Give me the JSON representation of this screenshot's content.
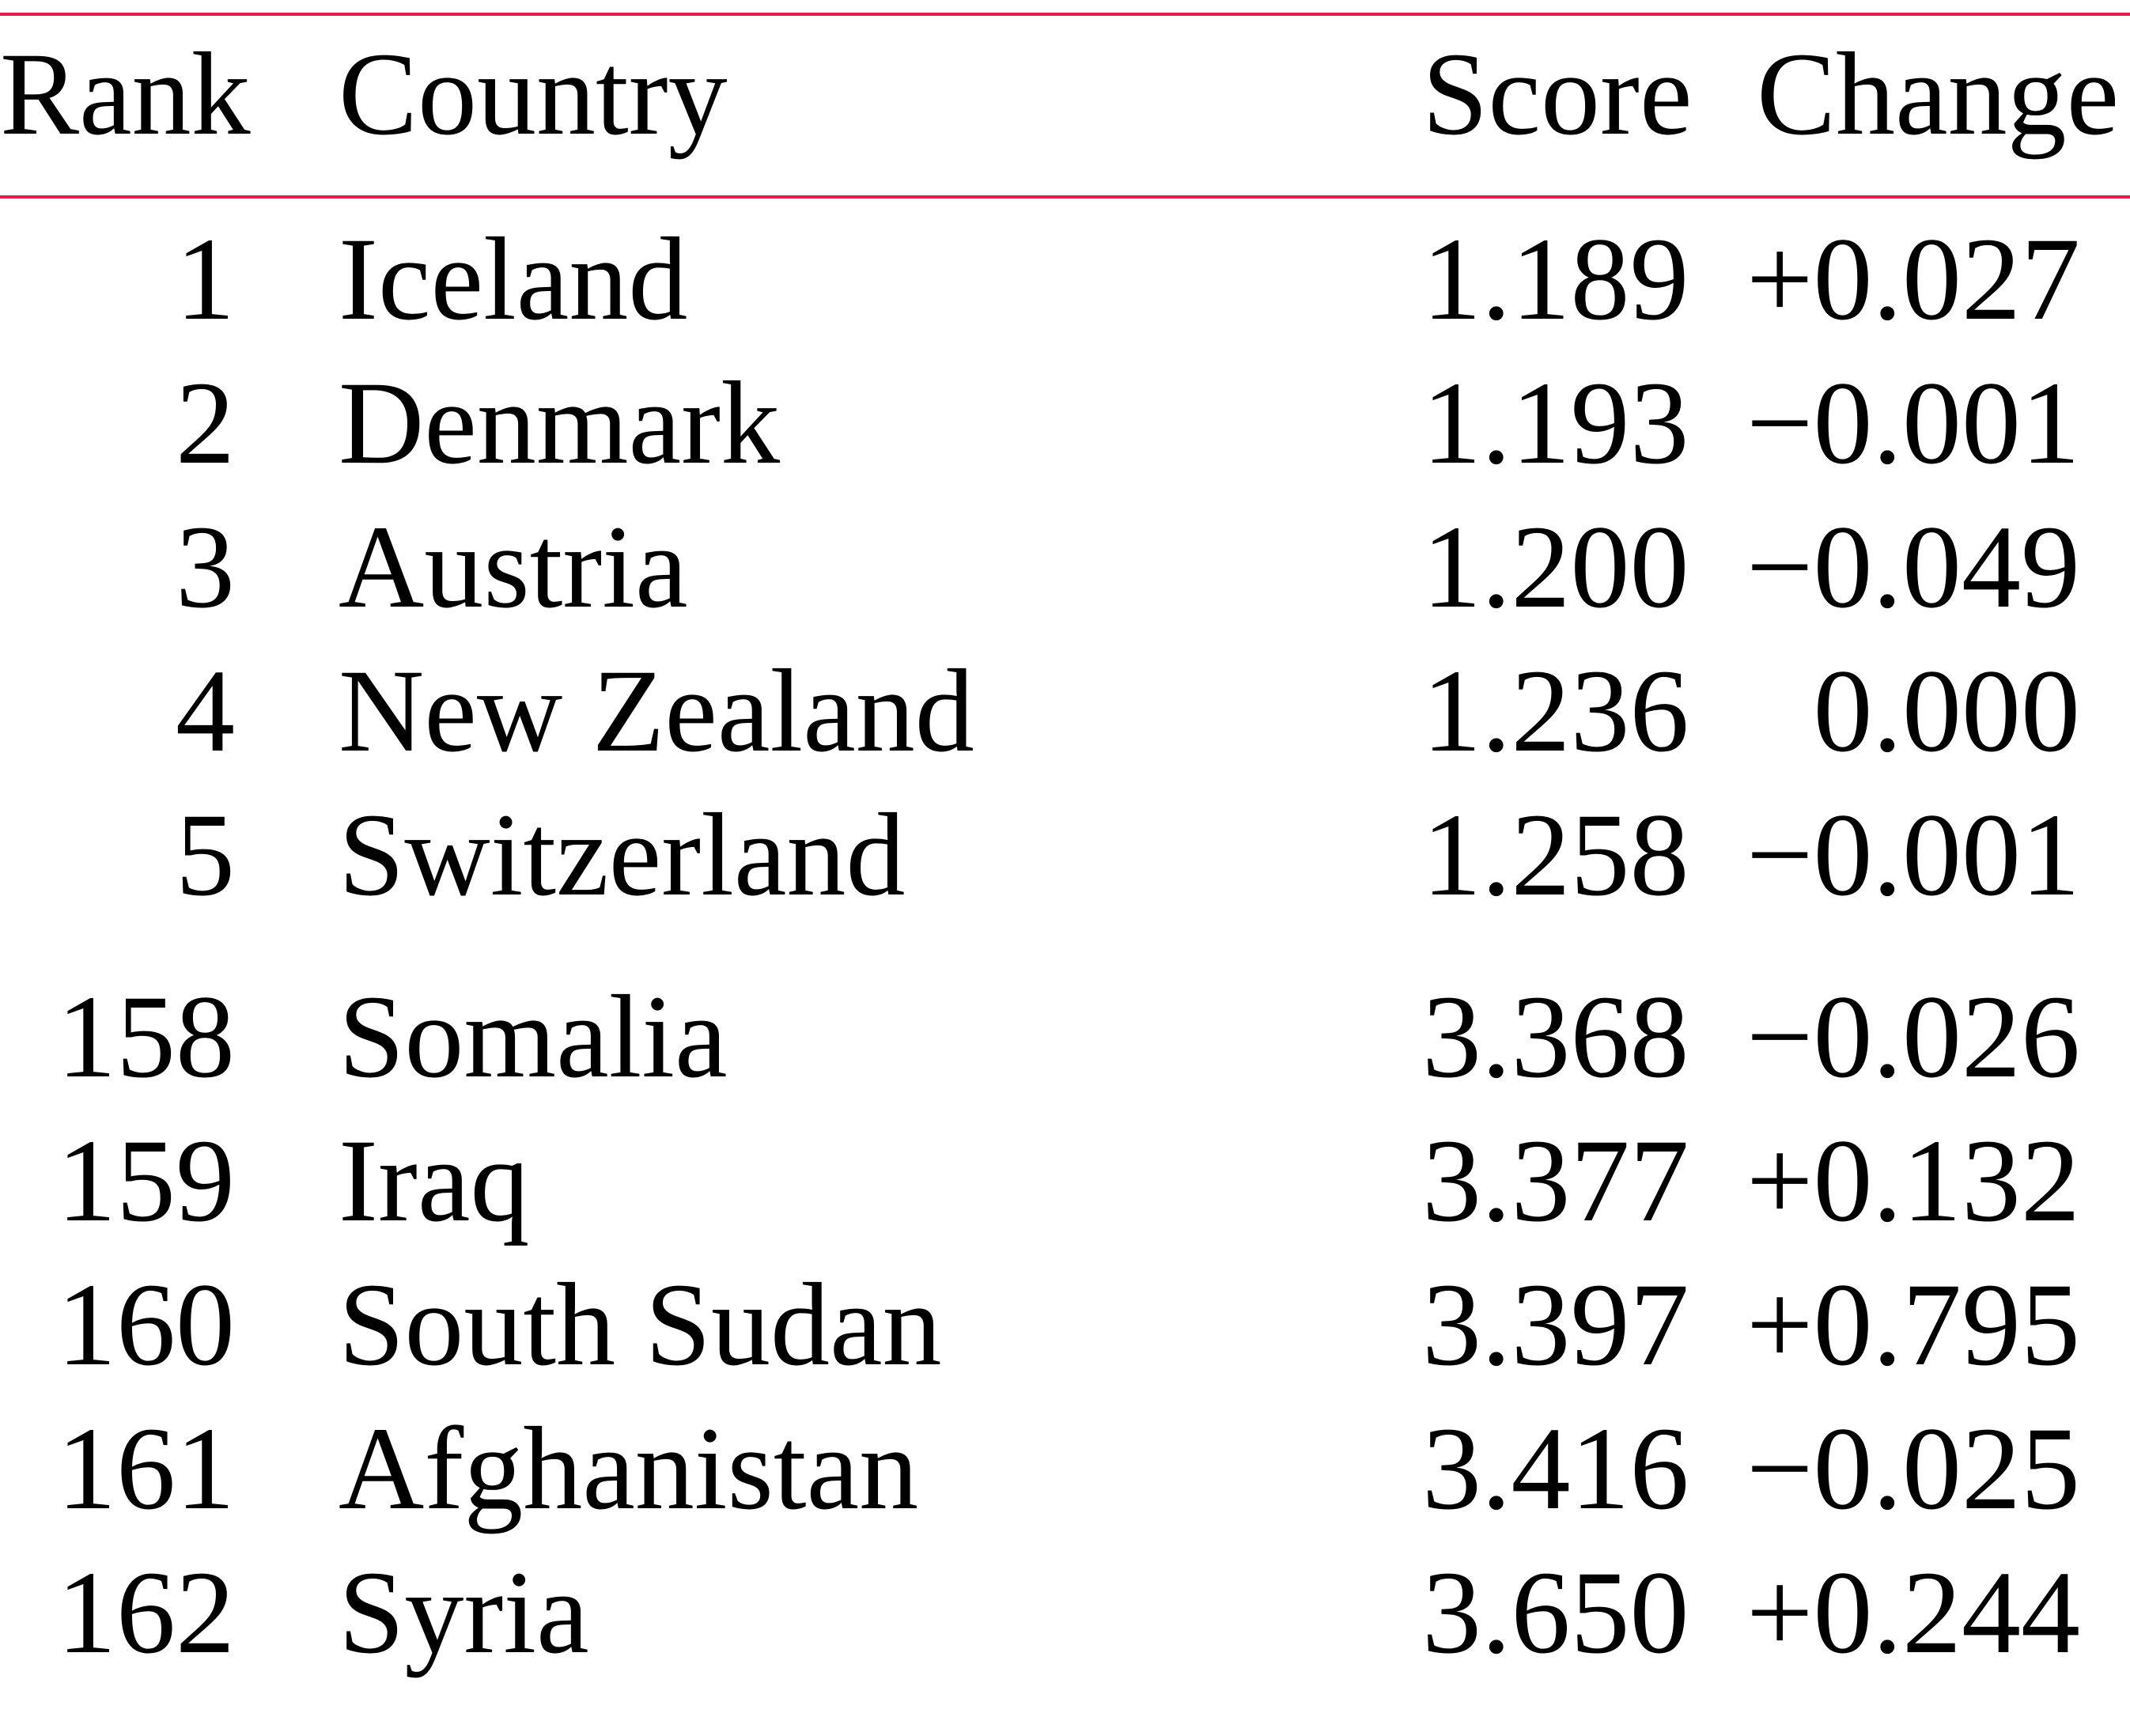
{
  "table": {
    "accent_color": "#e8194b",
    "headers": {
      "rank": "Rank",
      "country": "Country",
      "score": "Score",
      "change": "Change"
    },
    "rows": [
      {
        "rank": "1",
        "country": "Iceland",
        "score": "1.189",
        "change": "+0.027"
      },
      {
        "rank": "2",
        "country": "Denmark",
        "score": "1.193",
        "change": "−0.001"
      },
      {
        "rank": "3",
        "country": "Austria",
        "score": "1.200",
        "change": "−0.049"
      },
      {
        "rank": "4",
        "country": "New Zealand",
        "score": "1.236",
        "change": "0.000"
      },
      {
        "rank": "5",
        "country": "Switzerland",
        "score": "1.258",
        "change": "−0.001"
      },
      {
        "rank": "158",
        "country": "Somalia",
        "score": "3.368",
        "change": "−0.026"
      },
      {
        "rank": "159",
        "country": "Iraq",
        "score": "3.377",
        "change": "+0.132"
      },
      {
        "rank": "160",
        "country": "South Sudan",
        "score": "3.397",
        "change": "+0.795"
      },
      {
        "rank": "161",
        "country": "Afghanistan",
        "score": "3.416",
        "change": "−0.025"
      },
      {
        "rank": "162",
        "country": "Syria",
        "score": "3.650",
        "change": "+0.244"
      }
    ]
  }
}
